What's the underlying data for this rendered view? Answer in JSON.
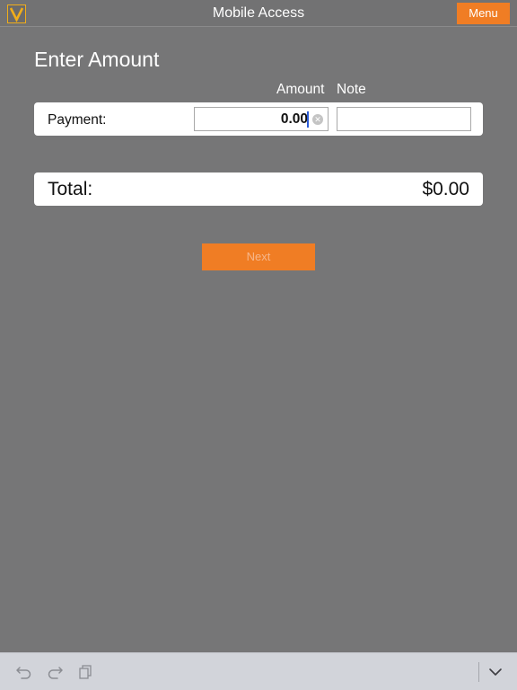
{
  "navbar": {
    "title": "Mobile Access",
    "menu_label": "Menu",
    "logo_icon": "v-logo-icon"
  },
  "form": {
    "heading": "Enter Amount",
    "col_amount": "Amount",
    "col_note": "Note",
    "payment_label": "Payment:",
    "amount_value": "0.00",
    "note_value": ""
  },
  "total": {
    "label": "Total:",
    "value": "$0.00"
  },
  "next_label": "Next",
  "toolbar": {
    "icons": [
      "undo-icon",
      "redo-icon",
      "paste-icon",
      "keyboard-dismiss-icon"
    ]
  },
  "colors": {
    "background": "#767677",
    "accent": "#f07d24",
    "logo_accent": "#f0ad1a",
    "card": "#ffffff"
  }
}
